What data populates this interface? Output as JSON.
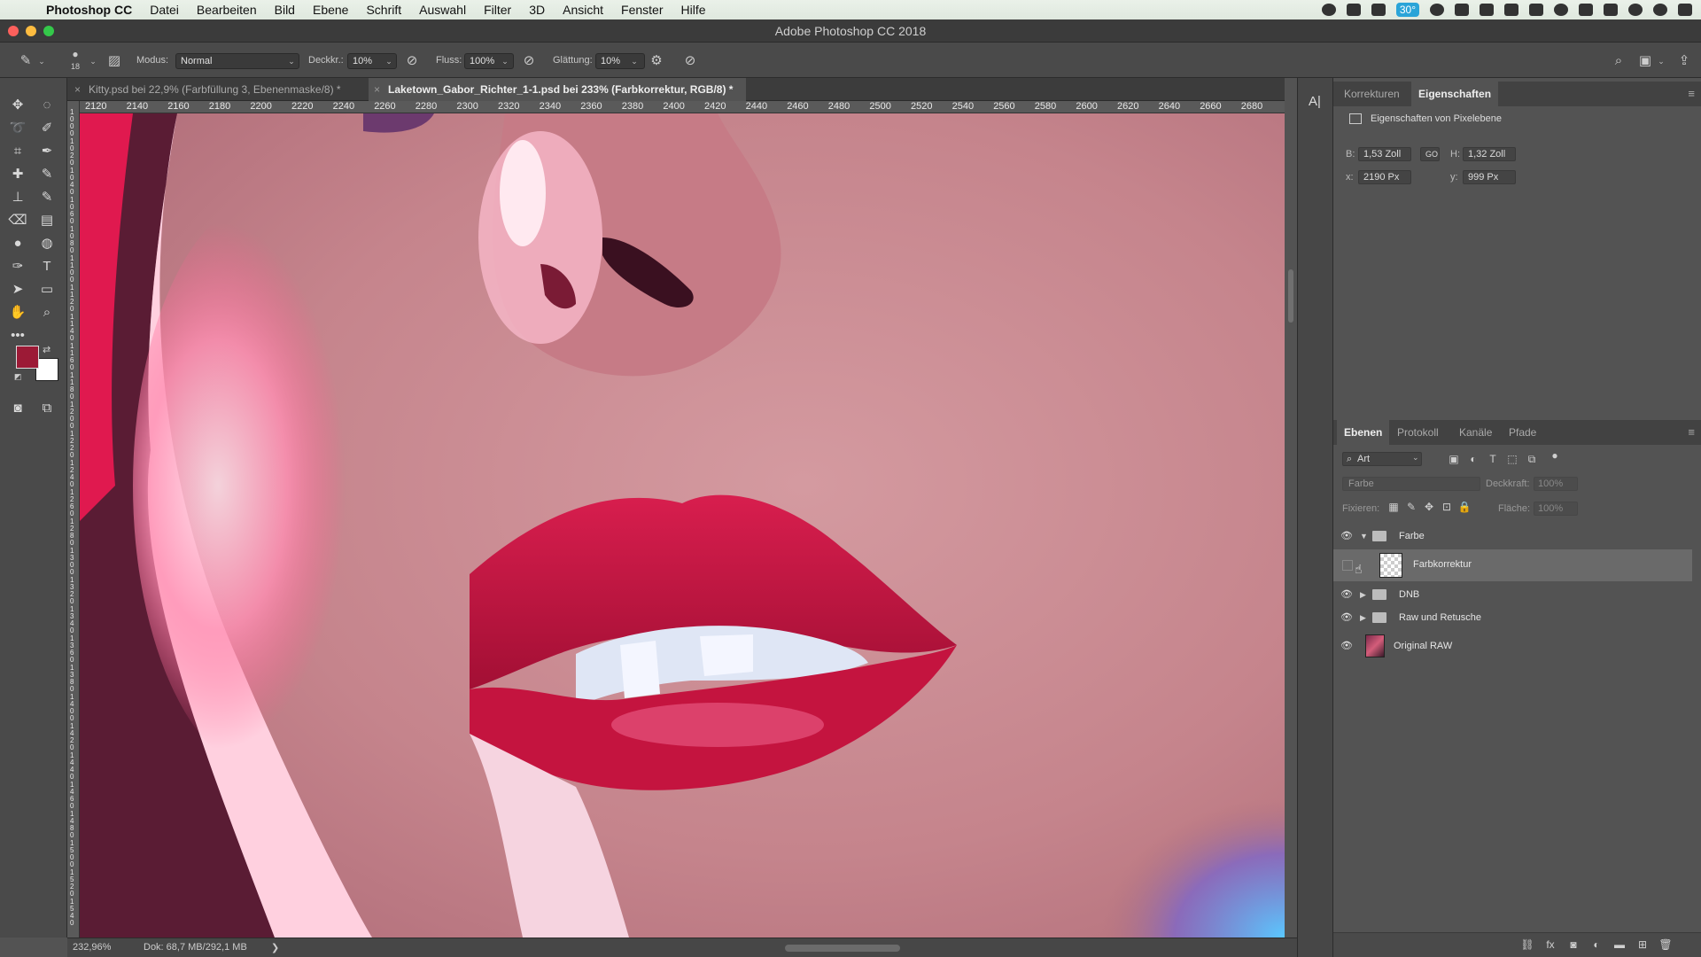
{
  "menubar": {
    "app": "Photoshop CC",
    "items": [
      "Datei",
      "Bearbeiten",
      "Bild",
      "Ebene",
      "Schrift",
      "Auswahl",
      "Filter",
      "3D",
      "Ansicht",
      "Fenster",
      "Hilfe"
    ],
    "battery_badge": "30°"
  },
  "window": {
    "title": "Adobe Photoshop CC 2018"
  },
  "options": {
    "brush_size": "18",
    "mode_label": "Modus:",
    "mode_value": "Normal",
    "opacity_label": "Deckkr.:",
    "opacity_value": "10%",
    "flow_label": "Fluss:",
    "flow_value": "100%",
    "smoothing_label": "Glättung:",
    "smoothing_value": "10%"
  },
  "tabs": [
    {
      "label": "Kitty.psd bei 22,9% (Farbfüllung 3, Ebenenmaske/8) *"
    },
    {
      "label": "Laketown_Gabor_Richter_1-1.psd bei 233% (Farbkorrektur, RGB/8) *"
    }
  ],
  "ruler_top": [
    "2120",
    "2140",
    "2160",
    "2180",
    "2200",
    "2220",
    "2240",
    "2260",
    "2280",
    "2300",
    "2320",
    "2340",
    "2360",
    "2380",
    "2400",
    "2420",
    "2440",
    "2460",
    "2480",
    "2500",
    "2520",
    "2540",
    "2560",
    "2580",
    "2600",
    "2620",
    "2640",
    "2660",
    "2680"
  ],
  "ruler_left": [
    [
      "1",
      "0",
      "0",
      "0"
    ],
    [
      "1",
      "0",
      "2",
      "0"
    ],
    [
      "1",
      "0",
      "4",
      "0"
    ],
    [
      "1",
      "0",
      "6",
      "0"
    ],
    [
      "1",
      "0",
      "8",
      "0"
    ],
    [
      "1",
      "1",
      "0",
      "0"
    ],
    [
      "1",
      "1",
      "2",
      "0"
    ],
    [
      "1",
      "1",
      "4",
      "0"
    ],
    [
      "1",
      "1",
      "6",
      "0"
    ],
    [
      "1",
      "1",
      "8",
      "0"
    ],
    [
      "1",
      "2",
      "0",
      "0"
    ],
    [
      "1",
      "2",
      "2",
      "0"
    ],
    [
      "1",
      "2",
      "4",
      "0"
    ],
    [
      "1",
      "2",
      "6",
      "0"
    ],
    [
      "1",
      "2",
      "8",
      "0"
    ],
    [
      "1",
      "3",
      "0",
      "0"
    ],
    [
      "1",
      "3",
      "2",
      "0"
    ],
    [
      "1",
      "3",
      "4",
      "0"
    ],
    [
      "1",
      "3",
      "6",
      "0"
    ],
    [
      "1",
      "3",
      "8",
      "0"
    ],
    [
      "1",
      "4",
      "0",
      "0"
    ],
    [
      "1",
      "4",
      "2",
      "0"
    ],
    [
      "1",
      "4",
      "4",
      "0"
    ],
    [
      "1",
      "4",
      "6",
      "0"
    ],
    [
      "1",
      "4",
      "8",
      "0"
    ],
    [
      "1",
      "5",
      "0",
      "0"
    ],
    [
      "1",
      "5",
      "2",
      "0"
    ],
    [
      "1",
      "5",
      "4",
      "0"
    ]
  ],
  "status": {
    "zoom": "232,96%",
    "doc": "Dok: 68,7 MB/292,1 MB",
    "arrow": "❯"
  },
  "properties": {
    "tabs": [
      "Korrekturen",
      "Eigenschaften"
    ],
    "heading": "Eigenschaften von Pixelebene",
    "w_label": "B:",
    "w_value": "1,53 Zoll",
    "link": "GO",
    "h_label": "H:",
    "h_value": "1,32 Zoll",
    "x_label": "x:",
    "x_value": "2190 Px",
    "y_label": "y:",
    "y_value": "999 Px"
  },
  "layers": {
    "tabs": [
      "Ebenen",
      "Protokoll",
      "Kanäle",
      "Pfade"
    ],
    "filter_kind": "Art",
    "blend_mode": "Farbe",
    "opacity_label": "Deckkraft:",
    "opacity_value": "100%",
    "lock_label": "Fixieren:",
    "fill_label": "Fläche:",
    "fill_value": "100%",
    "items": [
      {
        "name": "Farbe"
      },
      {
        "name": "Farbkorrektur"
      },
      {
        "name": "DNB"
      },
      {
        "name": "Raw und Retusche"
      },
      {
        "name": "Original RAW"
      }
    ]
  },
  "colors": {
    "foreground": "#9c1a36",
    "background": "#ffffff",
    "accent": "#2aa4d8"
  },
  "icons": {
    "apple": "",
    "menu": "≡",
    "close": "×",
    "search": "⌕"
  }
}
